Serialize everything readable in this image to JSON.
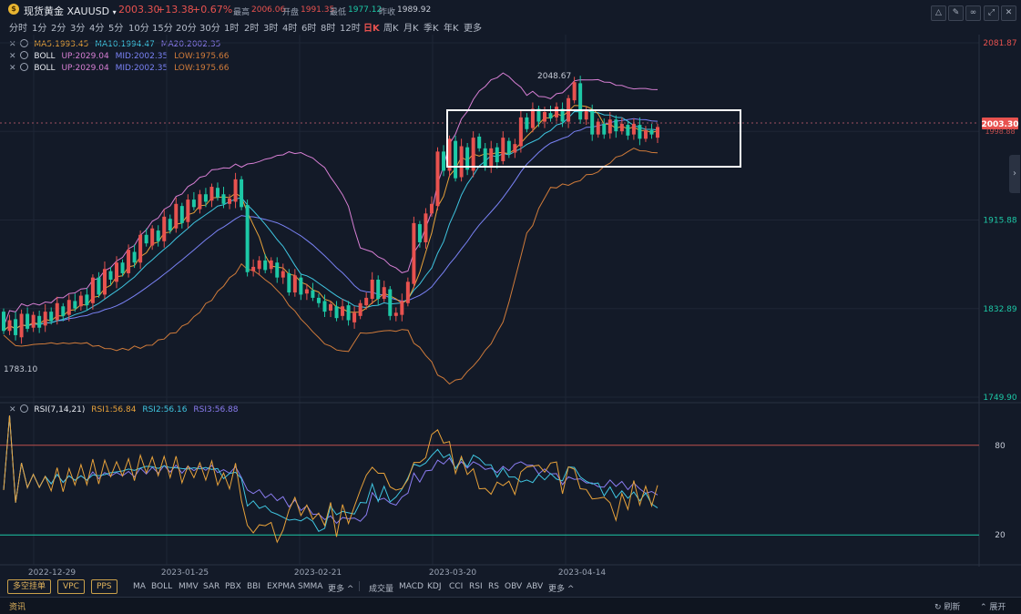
{
  "header": {
    "symbol": "现货黄金 XAUUSD",
    "dropdown_arrow": "▾",
    "price": "2003.30",
    "change": "+13.38",
    "change_pct": "+0.67%",
    "high_label": "最高",
    "high": "2006.06",
    "open_label": "开盘",
    "open": "1991.35",
    "low_label": "最低",
    "low": "1977.12",
    "prevclose_label": "昨收",
    "prevclose": "1989.92"
  },
  "timeframes": [
    "分时",
    "1分",
    "2分",
    "3分",
    "4分",
    "5分",
    "10分",
    "15分",
    "20分",
    "30分",
    "1时",
    "2时",
    "3时",
    "4时",
    "6时",
    "8时",
    "12时",
    "日K",
    "周K",
    "月K",
    "季K",
    "年K",
    "更多"
  ],
  "active_timeframe": "日K",
  "window_buttons": [
    "shape-tool-icon",
    "pen-icon",
    "link-icon",
    "expand-icon",
    "close-icon"
  ],
  "indicators": {
    "ma": {
      "a": "MA5:1993.45",
      "b": "MA10:1994.47",
      "c": "MA20:2002.35"
    },
    "boll1": {
      "name": "BOLL",
      "up": "UP:2029.04",
      "mid": "MID:2002.35",
      "low": "LOW:1975.66"
    },
    "boll2": {
      "name": "BOLL",
      "up": "UP:2029.04",
      "mid": "MID:2002.35",
      "low": "LOW:1975.66"
    },
    "rsi": {
      "name": "RSI(7,14,21)",
      "r1": "RSI1:56.84",
      "r2": "RSI2:56.16",
      "r3": "RSI3:56.88"
    }
  },
  "price_axis": {
    "labels": [
      "2081.87",
      "1915.88",
      "1832.89",
      "1749.90"
    ],
    "current": "2003.30",
    "under_current": "1998.88"
  },
  "chart_annotations": {
    "high_label": "2048.67",
    "low_label": "1783.10"
  },
  "rsi_axis": {
    "labels": [
      "80",
      "20"
    ]
  },
  "date_axis": [
    "2022-12-29",
    "2023-01-25",
    "2023-02-21",
    "2023-03-20",
    "2023-04-14"
  ],
  "bottom_tags": [
    "多空挂单",
    "VPC",
    "PPS"
  ],
  "main_tools": [
    "MA",
    "BOLL",
    "MMV",
    "SAR",
    "PBX",
    "BBI",
    "EXPMA",
    "SMMA",
    "更多 ^"
  ],
  "sub_tools": [
    "成交量",
    "MACD",
    "KDJ",
    "CCI",
    "RSI",
    "RS",
    "OBV",
    "ABV",
    "更多 ^"
  ],
  "news": {
    "label": "资讯",
    "refresh": "刷新",
    "expand": "展开"
  },
  "colors": {
    "up": "#e8524f",
    "down": "#1dc8a6",
    "ma5": "#e8a23a",
    "ma10": "#3fc5e0",
    "ma20": "#8a7cf0",
    "boll_up": "#d77fd4",
    "boll_mid": "#7a82f5",
    "boll_low": "#d07b3a",
    "bg": "#131a28"
  },
  "chart_data": {
    "type": "candlestick",
    "y_axis_range": [
      1749.9,
      2081.87
    ],
    "candles": [
      [
        1830,
        1812
      ],
      [
        1812,
        1822
      ],
      [
        1823,
        1808
      ],
      [
        1806,
        1828
      ],
      [
        1828,
        1814
      ],
      [
        1815,
        1827
      ],
      [
        1826,
        1815
      ],
      [
        1817,
        1830
      ],
      [
        1830,
        1821
      ],
      [
        1822,
        1838
      ],
      [
        1835,
        1826
      ],
      [
        1827,
        1841
      ],
      [
        1840,
        1833
      ],
      [
        1835,
        1845
      ],
      [
        1846,
        1836
      ],
      [
        1838,
        1862
      ],
      [
        1862,
        1846
      ],
      [
        1846,
        1870
      ],
      [
        1868,
        1860
      ],
      [
        1858,
        1876
      ],
      [
        1876,
        1866
      ],
      [
        1866,
        1888
      ],
      [
        1886,
        1876
      ],
      [
        1876,
        1902
      ],
      [
        1902,
        1894
      ],
      [
        1892,
        1908
      ],
      [
        1906,
        1896
      ],
      [
        1896,
        1919
      ],
      [
        1917,
        1906
      ],
      [
        1908,
        1931
      ],
      [
        1929,
        1913
      ],
      [
        1914,
        1935
      ],
      [
        1935,
        1928
      ],
      [
        1926,
        1940
      ],
      [
        1940,
        1933
      ],
      [
        1934,
        1947
      ],
      [
        1946,
        1937
      ],
      [
        1940,
        1931
      ],
      [
        1931,
        1936
      ],
      [
        1933,
        1954
      ],
      [
        1954,
        1928
      ],
      [
        1930,
        1867
      ],
      [
        1868,
        1872
      ],
      [
        1870,
        1878
      ],
      [
        1878,
        1869
      ],
      [
        1870,
        1878
      ],
      [
        1876,
        1862
      ],
      [
        1862,
        1868
      ],
      [
        1866,
        1848
      ],
      [
        1848,
        1864
      ],
      [
        1862,
        1846
      ],
      [
        1847,
        1851
      ],
      [
        1850,
        1843
      ],
      [
        1843,
        1838
      ],
      [
        1840,
        1830
      ],
      [
        1831,
        1837
      ],
      [
        1835,
        1824
      ],
      [
        1826,
        1835
      ],
      [
        1836,
        1822
      ],
      [
        1820,
        1829
      ],
      [
        1826,
        1838
      ],
      [
        1836,
        1843
      ],
      [
        1842,
        1860
      ],
      [
        1860,
        1842
      ],
      [
        1842,
        1853
      ],
      [
        1851,
        1826
      ],
      [
        1826,
        1829
      ],
      [
        1827,
        1840
      ],
      [
        1838,
        1858
      ],
      [
        1856,
        1913
      ],
      [
        1912,
        1895
      ],
      [
        1895,
        1922
      ],
      [
        1922,
        1931
      ],
      [
        1929,
        1980
      ],
      [
        1980,
        1962
      ],
      [
        1962,
        1992
      ],
      [
        1990,
        1955
      ],
      [
        1956,
        1985
      ],
      [
        1984,
        1963
      ],
      [
        1962,
        1993
      ],
      [
        1994,
        1983
      ],
      [
        1983,
        1966
      ],
      [
        1965,
        1983
      ],
      [
        1984,
        1970
      ],
      [
        1971,
        1993
      ],
      [
        1990,
        1978
      ],
      [
        1979,
        1987
      ],
      [
        1985,
        2012
      ],
      [
        2012,
        2001
      ],
      [
        2002,
        2020
      ],
      [
        2020,
        2008
      ],
      [
        2008,
        2017
      ],
      [
        2016,
        2011
      ],
      [
        2012,
        2022
      ],
      [
        2020,
        2008
      ],
      [
        2008,
        2030
      ],
      [
        2028,
        2045
      ],
      [
        2044,
        2010
      ],
      [
        2010,
        2018
      ],
      [
        2018,
        1996
      ],
      [
        1996,
        2008
      ],
      [
        2006,
        1996
      ],
      [
        1997,
        2010
      ],
      [
        2010,
        1999
      ],
      [
        1999,
        2006
      ],
      [
        2005,
        1995
      ],
      [
        1996,
        2006
      ],
      [
        2005,
        1992
      ],
      [
        1992,
        2000
      ],
      [
        2000,
        1996
      ],
      [
        1993,
        2003
      ]
    ]
  }
}
